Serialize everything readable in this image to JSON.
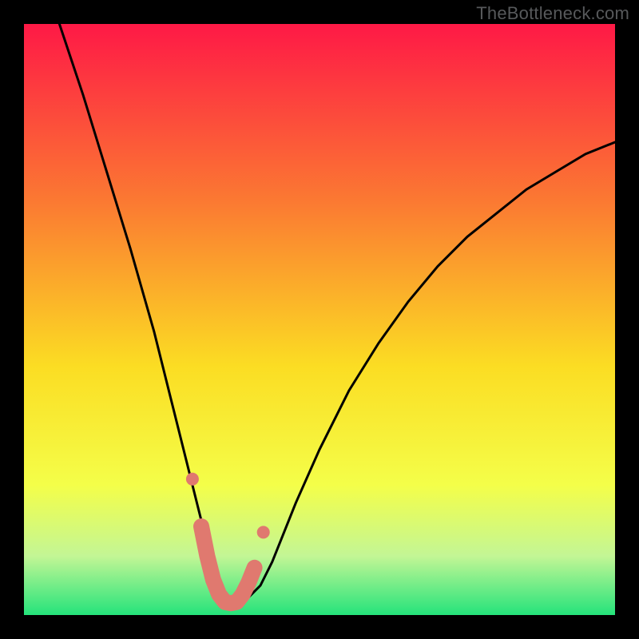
{
  "watermark": "TheBottleneck.com",
  "colors": {
    "border": "#000000",
    "gradient_top": "#fe1946",
    "gradient_mid_upper": "#fb7932",
    "gradient_mid": "#fbdd23",
    "gradient_lower": "#f4fe49",
    "gradient_green_pale": "#c3f695",
    "gradient_green": "#25e37b",
    "curve": "#000000",
    "marker_fill": "#e0796f",
    "marker_stroke": "#da6b61"
  },
  "chart_data": {
    "type": "line",
    "title": "",
    "xlabel": "",
    "ylabel": "",
    "xlim": [
      0,
      100
    ],
    "ylim": [
      0,
      100
    ],
    "grid": false,
    "series": [
      {
        "name": "bottleneck-curve",
        "x": [
          6,
          10,
          14,
          18,
          22,
          25,
          27,
          29,
          31,
          32,
          33,
          34,
          35,
          36,
          37,
          38,
          40,
          42,
          44,
          46,
          50,
          55,
          60,
          65,
          70,
          75,
          80,
          85,
          90,
          95,
          100
        ],
        "y": [
          100,
          88,
          75,
          62,
          48,
          36,
          28,
          20,
          12,
          8,
          5,
          3,
          2,
          2,
          2,
          3,
          5,
          9,
          14,
          19,
          28,
          38,
          46,
          53,
          59,
          64,
          68,
          72,
          75,
          78,
          80
        ]
      }
    ],
    "markers": {
      "name": "highlighted-range",
      "x": [
        28.5,
        30.0,
        31.0,
        32.0,
        33.0,
        34.0,
        35.0,
        36.0,
        37.0,
        38.0,
        39.0,
        40.5
      ],
      "y": [
        23.0,
        15.0,
        10.0,
        6.0,
        3.5,
        2.2,
        2.0,
        2.2,
        3.5,
        5.5,
        8.0,
        14.0
      ]
    }
  }
}
